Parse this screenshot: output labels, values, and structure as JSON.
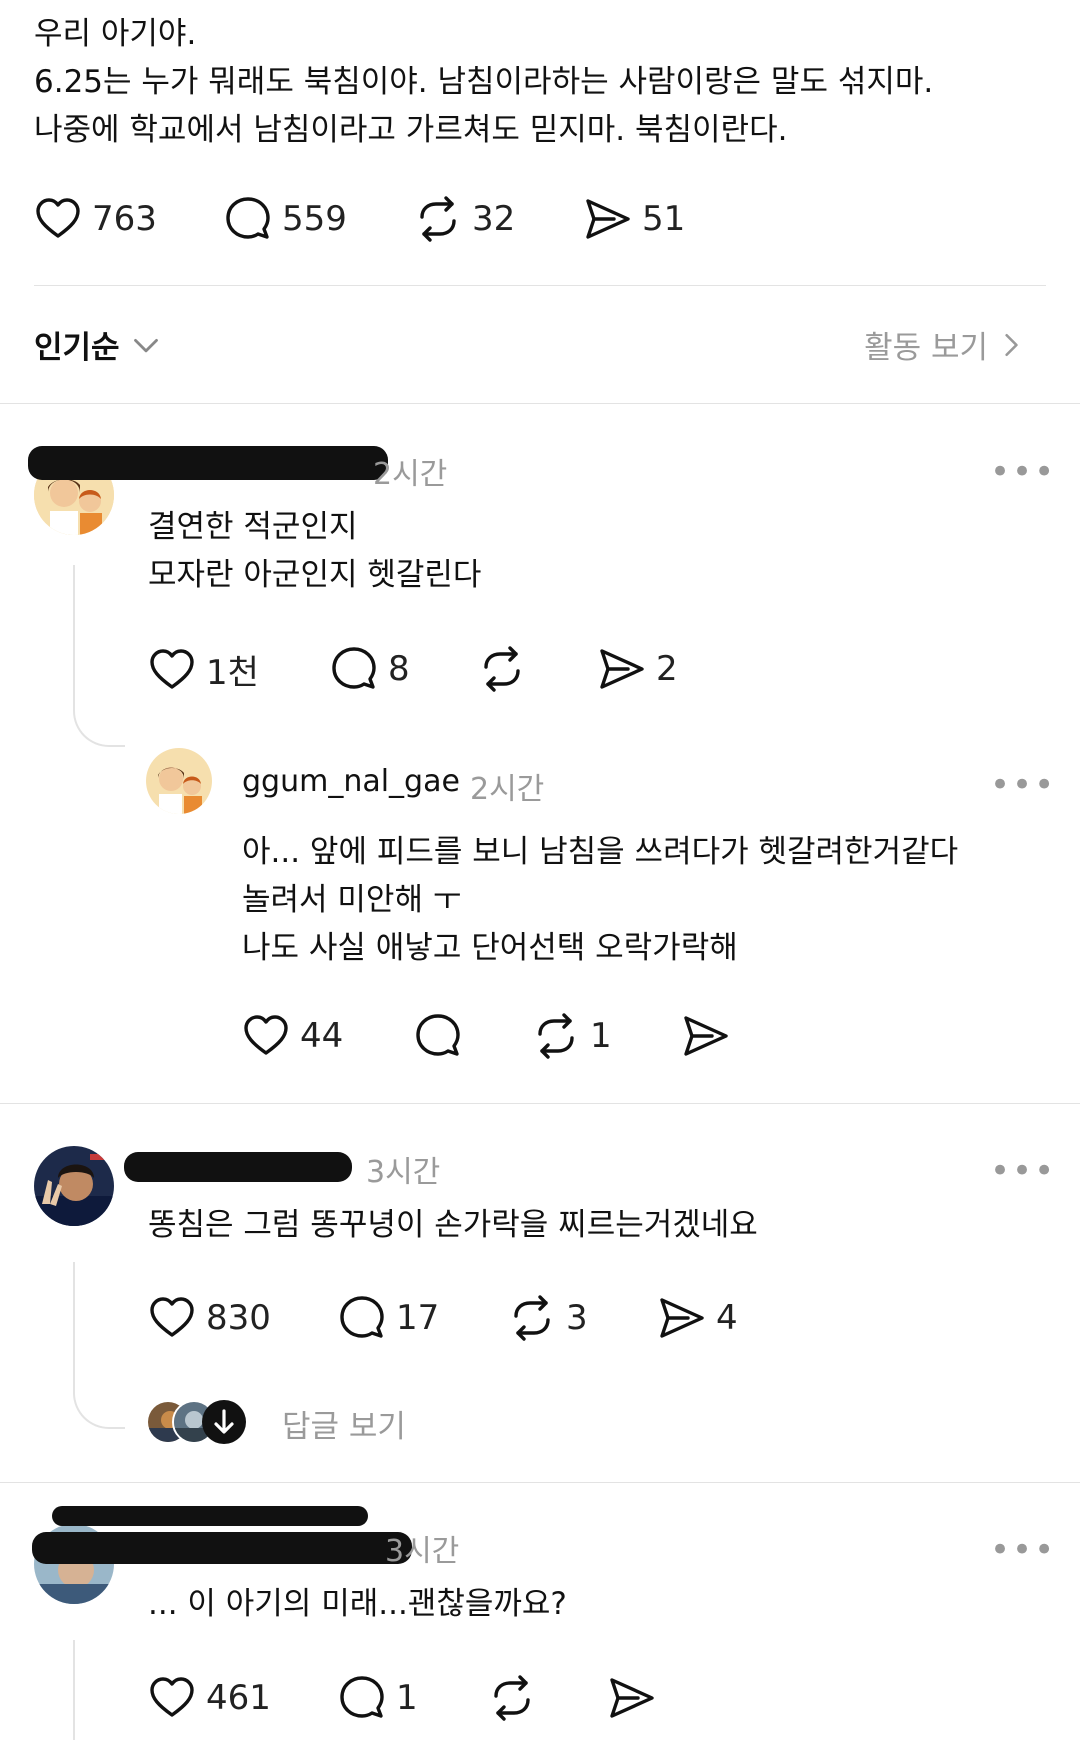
{
  "post": {
    "text": "우리 아기야.\n6.25는 누가 뭐래도 북침이야. 남침이라하는 사람이랑은 말도 섞지마.\n나중에 학교에서 남침이라고 가르쳐도 믿지마. 북침이란다.",
    "likes": "763",
    "comments": "559",
    "reposts": "32",
    "shares": "51"
  },
  "sort": {
    "label": "인기순",
    "activity_label": "활동 보기"
  },
  "comments": [
    {
      "username": "ggum_nal_gae",
      "time": "2시간",
      "text": "결연한 적군인지\n모자란 아군인지 헷갈린다",
      "likes": "1천",
      "comments": "8",
      "reposts": "",
      "shares": "2",
      "reply": {
        "username": "ggum_nal_gae",
        "time": "2시간",
        "text": "아... 앞에 피드를 보니 남침을 쓰려다가 헷갈려한거같다\n놀려서 미안해 ㅜ\n나도 사실 애낳고 단어선택 오락가락해",
        "likes": "44",
        "comments": "",
        "reposts": "1",
        "shares": ""
      }
    },
    {
      "username": "",
      "time": "3시간",
      "text": "똥침은 그럼 똥꾸녕이 손가락을 찌르는거겠네요",
      "likes": "830",
      "comments": "17",
      "reposts": "3",
      "shares": "4",
      "view_replies": "답글 보기"
    },
    {
      "username": "",
      "time": "3시간",
      "text": "... 이 아기의 미래...괜찮을까요?",
      "likes": "461",
      "comments": "1",
      "reposts": "",
      "shares": ""
    }
  ],
  "icons": {
    "like": "heart-icon",
    "comment": "comment-bubble-icon",
    "repost": "repost-icon",
    "share": "send-icon",
    "more": "more-dots-icon",
    "sort_chevron": "chevron-down-icon",
    "activity_chevron": "chevron-right-icon",
    "reply_down": "arrow-down-icon"
  },
  "colors": {
    "text": "#111111",
    "muted": "#9a9a9a",
    "divider": "#e3e3e3"
  }
}
